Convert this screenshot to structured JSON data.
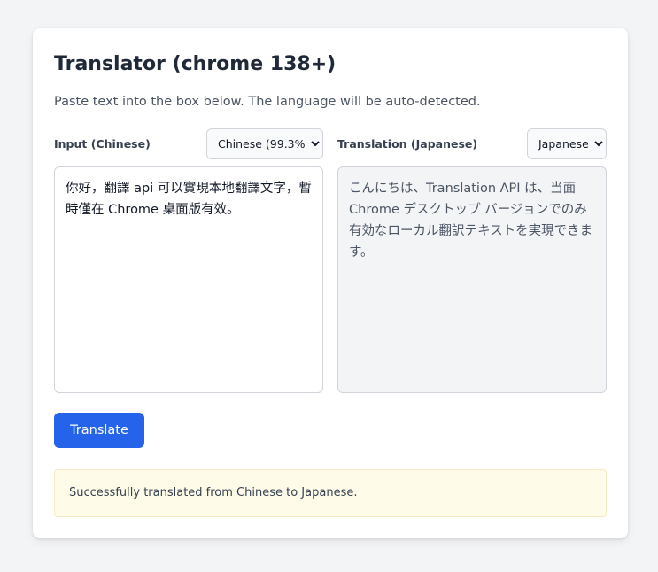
{
  "header": {
    "title": "Translator (chrome 138+)",
    "subtitle": "Paste text into the box below. The language will be auto-detected."
  },
  "input_panel": {
    "label": "Input (Chinese)",
    "language_select": {
      "selected": "Chinese (99.3%)"
    },
    "text": "你好，翻譯 api 可以實現本地翻譯文字，暫時僅在 Chrome 桌面版有效。"
  },
  "output_panel": {
    "label": "Translation (Japanese)",
    "language_select": {
      "selected": "Japanese"
    },
    "text": "こんにちは、Translation API は、当面 Chrome デスクトップ バージョンでのみ有効なローカル翻訳テキストを実現できます。"
  },
  "actions": {
    "translate_label": "Translate"
  },
  "status": {
    "message": "Successfully translated from Chinese to Japanese."
  },
  "colors": {
    "accent": "#2563eb",
    "background": "#f3f4f6",
    "status_bg": "#fefce8"
  }
}
